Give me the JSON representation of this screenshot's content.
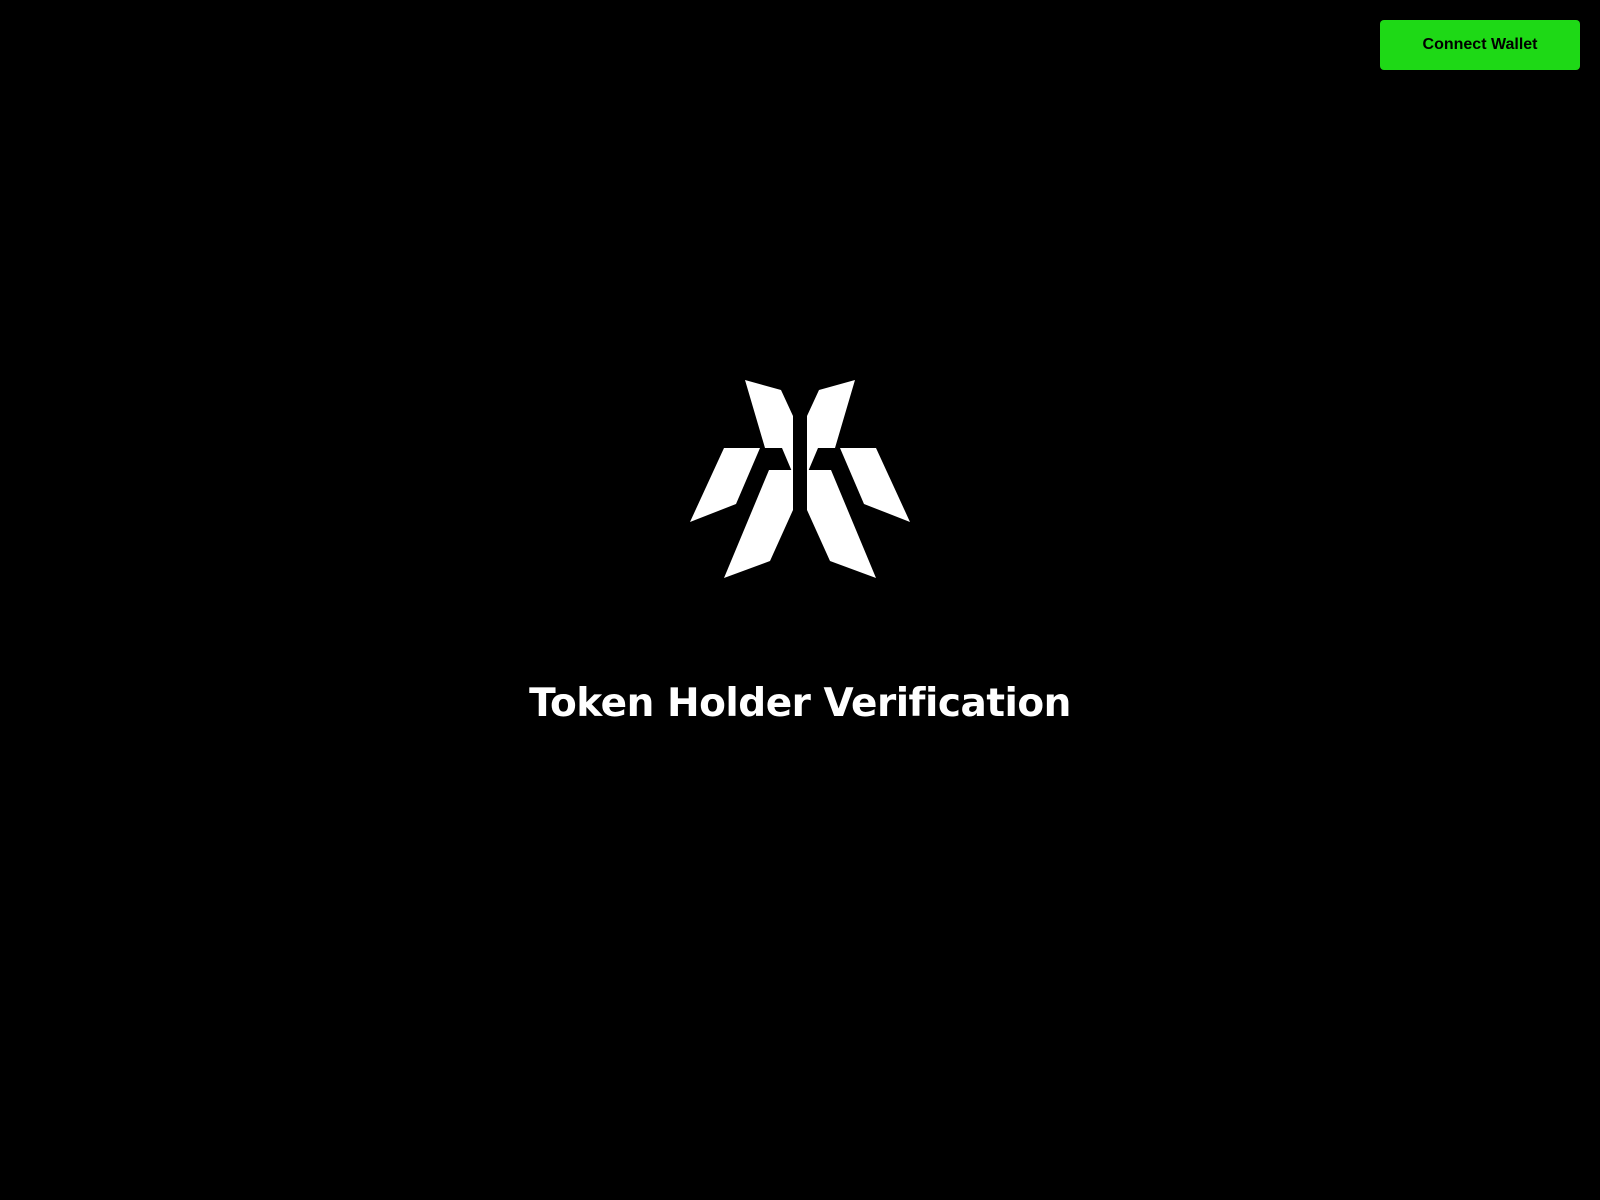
{
  "header": {
    "connect_wallet_label": "Connect Wallet"
  },
  "main": {
    "logo_icon": "brand-logo-icon",
    "title": "Token Holder Verification"
  },
  "colors": {
    "background": "#000000",
    "accent": "#1ed916",
    "text": "#ffffff"
  }
}
